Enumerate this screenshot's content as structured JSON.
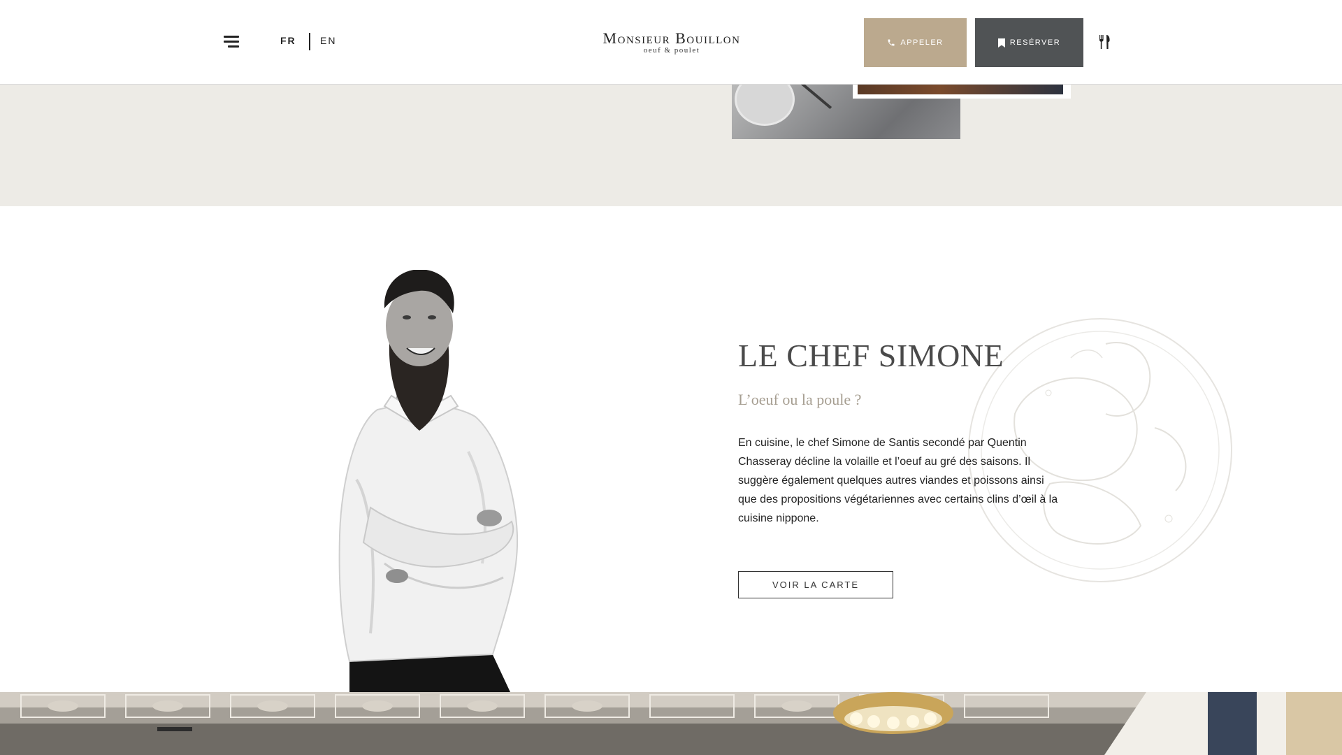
{
  "header": {
    "lang_fr": "FR",
    "lang_en": "EN",
    "logo_title": "Monsieur Bouillon",
    "logo_subtitle": "oeuf & poulet",
    "call_label": "APPELER",
    "book_label": "RESÉRVER",
    "icons": [
      "menu-icon",
      "phone-icon",
      "bookmark-icon",
      "fork-knife-icon"
    ]
  },
  "chef": {
    "title": "LE CHEF SIMONE",
    "subtitle": "L’oeuf ou la poule ?",
    "text": "En cuisine, le chef Simone de Santis secondé par Quentin Chasseray décline la volaille et l’oeuf au gré des saisons. Il suggère également quelques autres viandes et poissons ainsi que des propositions végétariennes avec certains clins d’œil à la cuisine nippone.",
    "cta_label": "VOIR LA CARTE"
  },
  "colors": {
    "call_button": "#bba98e",
    "book_button": "#505355",
    "beige_band": "#edebe6",
    "subtitle": "#a69e91"
  }
}
